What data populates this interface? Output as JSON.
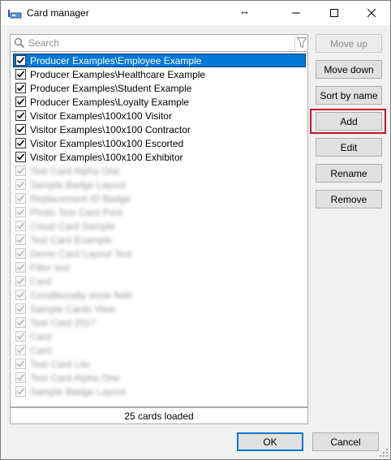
{
  "window": {
    "title": "Card manager",
    "resize_glyph": "↔",
    "icons": {
      "app": "card-manager-app-icon",
      "minimize": "minimize-icon",
      "maximize": "maximize-icon",
      "close": "close-icon"
    }
  },
  "search": {
    "placeholder": "Search",
    "value": "",
    "icons": {
      "search": "search-icon",
      "filter": "filter-icon"
    }
  },
  "list": {
    "items": [
      {
        "label": "Producer Examples\\Employee Example",
        "checked": true,
        "selected": true,
        "obscured": false
      },
      {
        "label": "Producer Examples\\Healthcare Example",
        "checked": true,
        "selected": false,
        "obscured": false
      },
      {
        "label": "Producer Examples\\Student Example",
        "checked": true,
        "selected": false,
        "obscured": false
      },
      {
        "label": "Producer Examples\\Loyalty Example",
        "checked": true,
        "selected": false,
        "obscured": false
      },
      {
        "label": "Visitor Examples\\100x100 Visitor",
        "checked": true,
        "selected": false,
        "obscured": false
      },
      {
        "label": "Visitor Examples\\100x100 Contractor",
        "checked": true,
        "selected": false,
        "obscured": false
      },
      {
        "label": "Visitor Examples\\100x100 Escorted",
        "checked": true,
        "selected": false,
        "obscured": false
      },
      {
        "label": "Visitor Examples\\100x100 Exhibitor",
        "checked": true,
        "selected": false,
        "obscured": false
      },
      {
        "label": "",
        "checked": true,
        "selected": false,
        "obscured": true
      },
      {
        "label": "",
        "checked": true,
        "selected": false,
        "obscured": true
      },
      {
        "label": "",
        "checked": true,
        "selected": false,
        "obscured": true
      },
      {
        "label": "",
        "checked": true,
        "selected": false,
        "obscured": true
      },
      {
        "label": "",
        "checked": true,
        "selected": false,
        "obscured": true
      },
      {
        "label": "",
        "checked": true,
        "selected": false,
        "obscured": true
      },
      {
        "label": "",
        "checked": true,
        "selected": false,
        "obscured": true
      },
      {
        "label": "",
        "checked": true,
        "selected": false,
        "obscured": true
      },
      {
        "label": "",
        "checked": true,
        "selected": false,
        "obscured": true
      },
      {
        "label": "",
        "checked": true,
        "selected": false,
        "obscured": true
      },
      {
        "label": "",
        "checked": true,
        "selected": false,
        "obscured": true
      },
      {
        "label": "",
        "checked": true,
        "selected": false,
        "obscured": true
      },
      {
        "label": "",
        "checked": true,
        "selected": false,
        "obscured": true
      },
      {
        "label": "",
        "checked": true,
        "selected": false,
        "obscured": true
      },
      {
        "label": "",
        "checked": true,
        "selected": false,
        "obscured": true
      },
      {
        "label": "",
        "checked": true,
        "selected": false,
        "obscured": true
      },
      {
        "label": "",
        "checked": true,
        "selected": false,
        "obscured": true
      }
    ],
    "status": "25 cards loaded"
  },
  "side_buttons": {
    "move_up": {
      "label": "Move up",
      "enabled": false
    },
    "move_down": {
      "label": "Move down",
      "enabled": true
    },
    "sort_by_name": {
      "label": "Sort by name",
      "enabled": true
    },
    "add": {
      "label": "Add",
      "enabled": true,
      "highlighted": true
    },
    "edit": {
      "label": "Edit",
      "enabled": true
    },
    "rename": {
      "label": "Rename",
      "enabled": true
    },
    "remove": {
      "label": "Remove",
      "enabled": true
    }
  },
  "footer": {
    "ok": {
      "label": "OK"
    },
    "cancel": {
      "label": "Cancel"
    }
  },
  "colors": {
    "selection": "#0078d7",
    "highlight_box": "#c8102e",
    "window_bg": "#f0f0f0",
    "button_bg": "#e1e1e1"
  }
}
